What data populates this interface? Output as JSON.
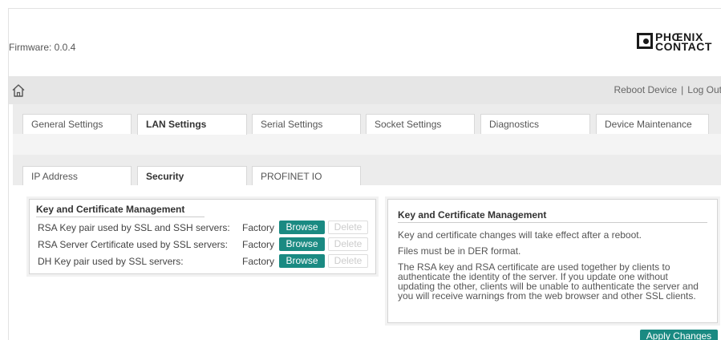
{
  "header": {
    "firmware": "Firmware: 0.0.4",
    "logo_text_line1": "PHŒNIX",
    "logo_text_line2": "CONTACT"
  },
  "topbar": {
    "home_icon": "home-icon",
    "reboot_label": "Reboot Device",
    "separator": "|",
    "logout_label": "Log Out"
  },
  "main_tabs": [
    {
      "label": "General Settings",
      "active": false
    },
    {
      "label": "LAN Settings",
      "active": true
    },
    {
      "label": "Serial Settings",
      "active": false
    },
    {
      "label": "Socket Settings",
      "active": false
    },
    {
      "label": "Diagnostics",
      "active": false
    },
    {
      "label": "Device Maintenance",
      "active": false
    }
  ],
  "sub_tabs": [
    {
      "label": "IP Address",
      "active": false
    },
    {
      "label": "Security",
      "active": true
    },
    {
      "label": "PROFINET IO",
      "active": false
    }
  ],
  "key_panel": {
    "title": "Key and Certificate Management",
    "rows": [
      {
        "label": "RSA Key pair used by SSL and SSH servers:",
        "value": "Factory",
        "browse": "Browse",
        "delete": "Delete"
      },
      {
        "label": "RSA Server Certificate used by SSL servers:",
        "value": "Factory",
        "browse": "Browse",
        "delete": "Delete"
      },
      {
        "label": "DH Key pair used by SSL servers:",
        "value": "Factory",
        "browse": "Browse",
        "delete": "Delete"
      }
    ]
  },
  "info_panel": {
    "title": "Key and Certificate Management",
    "p1": "Key and certificate changes will take effect after a reboot.",
    "p2": "Files must be in DER format.",
    "p3": "The RSA key and RSA certificate are used together by clients to authenticate the identity of the server. If you update one without updating the other, clients will be unable to authenticate the server and you will receive warnings from the web browser and other SSL clients."
  },
  "apply_label": "Apply Changes",
  "colors": {
    "accent": "#1a8a82",
    "bar_gray": "#e6e6e6"
  }
}
